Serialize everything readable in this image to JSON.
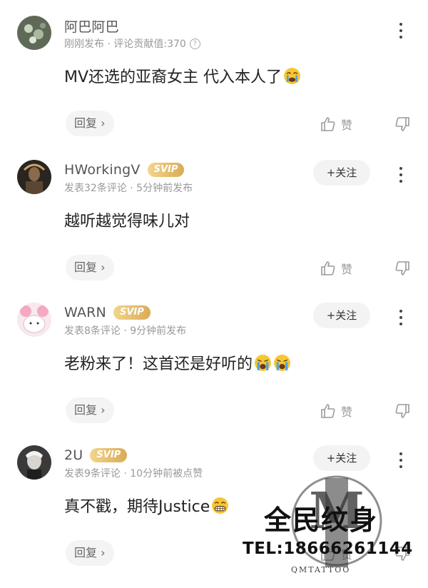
{
  "comments": [
    {
      "username": "阿巴阿巴",
      "badge": "",
      "meta": "刚刚发布 · 评论贡献值:370",
      "meta_help": "?",
      "follow_label": "",
      "text": "MV还选的亚裔女主 代入本人了",
      "emoji": [
        "crying-emoji"
      ],
      "reply_label": "回复 ›",
      "like_label": "赞"
    },
    {
      "username": "HWorkingV",
      "badge": "SVIP",
      "meta": "发表32条评论 · 5分钟前发布",
      "follow_label": "+关注",
      "text": "越听越觉得味儿对",
      "emoji": [],
      "reply_label": "回复 ›",
      "like_label": "赞"
    },
    {
      "username": "WARN",
      "badge": "SVIP",
      "meta": "发表8条评论 · 9分钟前发布",
      "follow_label": "+关注",
      "text": "老粉来了！这首还是好听的",
      "emoji": [
        "sobbing-emoji",
        "sobbing-emoji"
      ],
      "reply_label": "回复 ›",
      "like_label": "赞"
    },
    {
      "username": "2U",
      "badge": "SVIP",
      "meta": "发表9条评论 · 10分钟前被点赞",
      "follow_label": "+关注",
      "text": "真不戳，期待Justice",
      "emoji": [
        "grimacing-emoji"
      ],
      "reply_label": "回复 ›",
      "like_label": "赞"
    }
  ],
  "watermark": {
    "title": "全民纹身",
    "tel": "TEL:18666261144",
    "brand": "QMTATTOO",
    "letter": "M"
  },
  "colors": {
    "svip_gold": "#d9ab56",
    "meta_gray": "#999999",
    "pill_bg": "#f4f4f4"
  }
}
